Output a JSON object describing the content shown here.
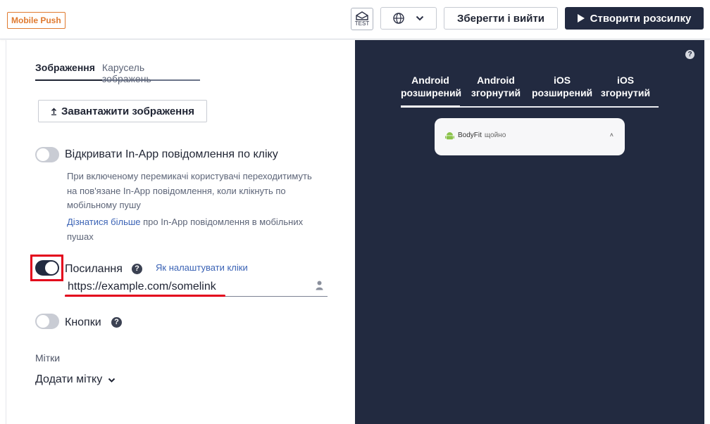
{
  "header": {
    "badge": "Mobile Push",
    "test_label": "TEST",
    "save_label": "Зберегти і вийти",
    "create_label": "Створити розсилку"
  },
  "content": {
    "tabs": [
      {
        "label": "Зображення",
        "active": true
      },
      {
        "label": "Карусель зображень",
        "active": false
      }
    ],
    "upload_label": "Завантажити зображення",
    "inapp": {
      "label": "Відкривати In-App повідомлення по кліку",
      "enabled": false,
      "help_line1": "При включеному перемикачі користувачі переходитимуть",
      "help_line2": "на пов'язане In-App повідомлення, коли клікнуть по",
      "help_line3": "мобільному пушу",
      "learn_more": "Дізнатися більше",
      "learn_rest1": " про In-App повідомлення в мобільних",
      "learn_rest2": "пушах"
    },
    "link": {
      "label": "Посилання",
      "enabled": true,
      "how_to": "Як налаштувати кліки",
      "url": "https://example.com/somelink"
    },
    "buttons": {
      "label": "Кнопки",
      "enabled": false
    },
    "tags": {
      "section_label": "Мітки",
      "add_label": "Додати мітку"
    }
  },
  "preview": {
    "tabs": [
      {
        "line1": "Android",
        "line2": "розширений",
        "active": true
      },
      {
        "line1": "Android",
        "line2": "згорнутий",
        "active": false
      },
      {
        "line1": "iOS",
        "line2": "розширений",
        "active": false
      },
      {
        "line1": "iOS",
        "line2": "згорнутий",
        "active": false
      }
    ],
    "notification": {
      "app_name": "BodyFit",
      "time": "щойно"
    }
  },
  "colors": {
    "accent_dark": "#222a40",
    "badge_orange": "#e07a2f",
    "highlight_red": "#e3001b",
    "link_blue": "#3b63b5"
  }
}
